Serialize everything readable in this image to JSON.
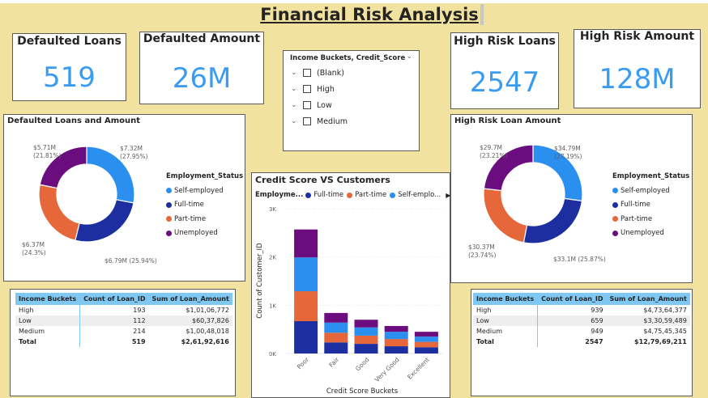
{
  "title": "Financial Risk Analysis",
  "colors": {
    "background": "#f1e29f",
    "self_employed": "#2b8ff0",
    "full_time": "#1d2fa0",
    "part_time": "#e5673a",
    "unemployed": "#6b0d7e",
    "accent_value": "#3a9cf0",
    "table_header": "#7ec8f3"
  },
  "cards": {
    "defaulted_loans": {
      "label": "Defaulted Loans",
      "value": "519"
    },
    "defaulted_amount": {
      "label": "Defaulted Amount",
      "value": "26M"
    },
    "high_risk_loans": {
      "label": "High Risk Loans",
      "value": "2547"
    },
    "high_risk_amount": {
      "label": "High Risk Amount",
      "value": "128M"
    }
  },
  "slicer": {
    "header": "Income Buckets, Credit_Score",
    "chevron_icon": "chevron-down-icon",
    "items": [
      "(Blank)",
      "High",
      "Low",
      "Medium"
    ]
  },
  "donut_legend": {
    "title": "Employment_Status",
    "items": [
      "Self-employed",
      "Full-time",
      "Part-time",
      "Unemployed"
    ]
  },
  "defaulted_donut": {
    "title": "Defaulted Loans and Amount",
    "labels": {
      "self_employed": [
        "$7.32M",
        "(27.95%)"
      ],
      "full_time": [
        "$6.79M (25.94%)"
      ],
      "part_time": [
        "$6.37M",
        "(24.3%)"
      ],
      "unemployed": [
        "$5.71M",
        "(21.81%)"
      ]
    }
  },
  "high_risk_donut": {
    "title": "High Risk Loan Amount",
    "labels": {
      "self_employed": [
        "$34.79M",
        "(27.19%)"
      ],
      "full_time": [
        "$33.1M (25.87%)"
      ],
      "part_time": [
        "$30.37M",
        "(23.74%)"
      ],
      "unemployed": [
        "$29.7M",
        "(23.21%)"
      ]
    }
  },
  "bar_chart": {
    "title": "Credit Score VS Customers",
    "legend_title": "Employme...",
    "legend_items": [
      "Full-time",
      "Part-time",
      "Self-emplo..."
    ],
    "legend_more_icon": "chevron-right-icon",
    "xlabel": "Credit Score Buckets",
    "ylabel": "Count of Customer_ID",
    "yticks": [
      "0K",
      "1K",
      "2K",
      "3K"
    ]
  },
  "defaulted_table": {
    "headers": [
      "Income Buckets",
      "Count of Loan_ID",
      "Sum of Loan_Amount"
    ],
    "rows": [
      [
        "High",
        "193",
        "$1,01,06,772"
      ],
      [
        "Low",
        "112",
        "$60,37,826"
      ],
      [
        "Medium",
        "214",
        "$1,00,48,018"
      ]
    ],
    "total": [
      "Total",
      "519",
      "$2,61,92,616"
    ]
  },
  "high_risk_table": {
    "headers": [
      "Income Buckets",
      "Count of Loan_ID",
      "Sum of Loan_Amount"
    ],
    "rows": [
      [
        "High",
        "939",
        "$4,73,64,377"
      ],
      [
        "Low",
        "659",
        "$3,30,59,489"
      ],
      [
        "Medium",
        "949",
        "$4,75,45,345"
      ]
    ],
    "total": [
      "Total",
      "2547",
      "$12,79,69,211"
    ]
  },
  "chart_data": [
    {
      "type": "pie",
      "title": "Defaulted Loans and Amount",
      "legend_title": "Employment_Status",
      "categories": [
        "Self-employed",
        "Full-time",
        "Part-time",
        "Unemployed"
      ],
      "values": [
        7.32,
        6.79,
        6.37,
        5.71
      ],
      "percent": [
        27.95,
        25.94,
        24.3,
        21.81
      ],
      "unit": "$M",
      "legend": "right"
    },
    {
      "type": "pie",
      "title": "High Risk Loan Amount",
      "legend_title": "Employment_Status",
      "categories": [
        "Self-employed",
        "Full-time",
        "Part-time",
        "Unemployed"
      ],
      "values": [
        34.79,
        33.1,
        30.37,
        29.7
      ],
      "percent": [
        27.19,
        25.87,
        23.74,
        23.21
      ],
      "unit": "$M",
      "legend": "right"
    },
    {
      "type": "bar",
      "stacked": true,
      "title": "Credit Score VS Customers",
      "categories": [
        "Poor",
        "Fair",
        "Good",
        "Very Good",
        "Excellent"
      ],
      "series": [
        {
          "name": "Full-time",
          "values": [
            670,
            230,
            200,
            150,
            130
          ]
        },
        {
          "name": "Part-time",
          "values": [
            620,
            200,
            170,
            150,
            110
          ]
        },
        {
          "name": "Self-employed",
          "values": [
            700,
            210,
            170,
            150,
            110
          ]
        },
        {
          "name": "Unemployed",
          "values": [
            580,
            200,
            160,
            120,
            100
          ]
        }
      ],
      "xlabel": "Credit Score Buckets",
      "ylabel": "Count of Customer_ID",
      "ylim": [
        0,
        3000
      ],
      "grid": true,
      "legend": "top"
    }
  ]
}
